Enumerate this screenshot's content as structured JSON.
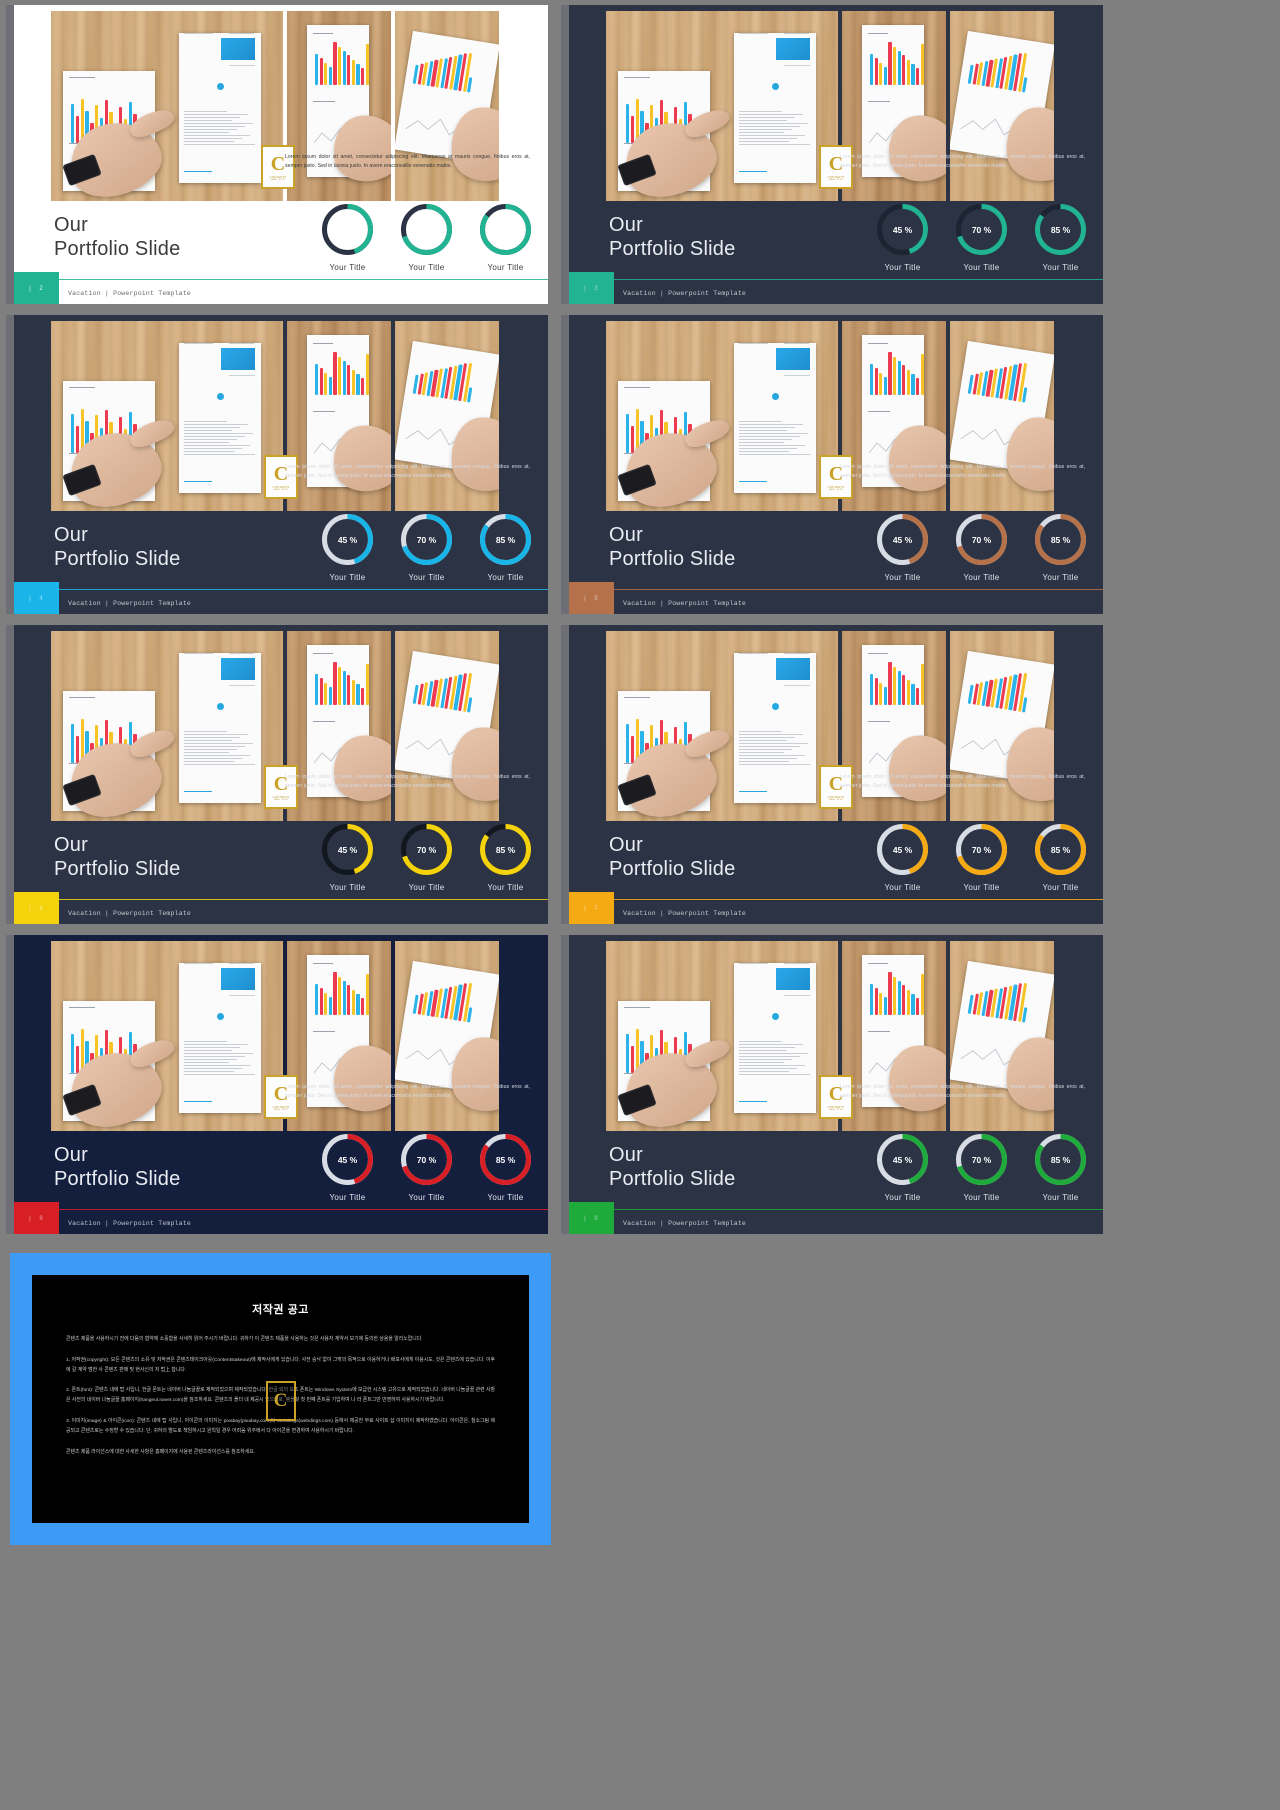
{
  "deck": {
    "headline_line1": "Our",
    "headline_line2": "Portfolio Slide",
    "body_text": "Lorem ipsum dolor sit amet, consectetur adipiscing elit. Maecenas at mauris congue, finibus eros at, semper justo. Sed in lacinia justo. In avere eraconvallis venenatis mattis.",
    "footer_text": "Vacation | Powerpoint Template",
    "donut_labels": [
      "Your Title",
      "Your Title",
      "Your Title"
    ],
    "donut_values": [
      "45 %",
      "70 %",
      "85 %"
    ],
    "donut_percents": [
      45,
      70,
      85
    ],
    "badge": {
      "letter": "C",
      "line1": "CONTENTS",
      "line2": "MALL SITE"
    }
  },
  "slides": [
    {
      "n": "| 2",
      "theme": "light",
      "accent": "#21b392",
      "track": "#2b3344",
      "page": "| 2"
    },
    {
      "n": "| 3",
      "theme": "dark",
      "accent": "#21b392",
      "track": "#1c2431",
      "page": "| 3"
    },
    {
      "n": "| 4",
      "theme": "dark",
      "accent": "#19b5e8",
      "track": "#d8dde5",
      "page": "| 4"
    },
    {
      "n": "| 5",
      "theme": "dark",
      "accent": "#b5714a",
      "track": "#d8dde5",
      "page": "| 5"
    },
    {
      "n": "| 6",
      "theme": "dark",
      "accent": "#f5d30c",
      "track": "#11161f",
      "page": "| 6"
    },
    {
      "n": "| 7",
      "theme": "dark",
      "accent": "#f5a913",
      "track": "#d8dde5",
      "page": "| 7"
    },
    {
      "n": "| 8",
      "theme": "navy",
      "accent": "#d81f26",
      "track": "#d8dde5",
      "page": "| 8"
    },
    {
      "n": "| 9",
      "theme": "dark",
      "accent": "#1faa3c",
      "track": "#d8dde5",
      "page": "| 9"
    }
  ],
  "copyright": {
    "title": "저작권 공고",
    "paragraphs": [
      "콘텐츠 제품을 사용하시기 전에 다음의 협약에 소홀함을 사세히 읽어 주시기 바랍니다. 귀하가 이 콘텐츠 제품을 사용하는 것은 사용자 계약서 보기에 동의한 상용을 알리노랍니다.",
      "1. 저작권(copyright): 모든 콘텐츠의 소유 및 저작권은 콘텐츠테이크아웃(Contentstakeout)에 제작사에게 있습니다. 사전 승낙 없이 그밖의 목적으로 이용하거나 배포사에게 이용시도, 것은 콘텐츠에 있습니다. 이후에 갈 계약 범한 사 콘텐츠 판매 및 현사신의 저 법上 합니다.",
      "2. 폰트(font): 콘텐츠 내에 탑 사입니, 한글 폰트는 네이버 나눔글꼴로 제작되었으며 제작되었습니다. 한글 외의 보조 폰트는 Windows System에 보급한 시스템 고유으로 제작되었습니다. 네이버 나눔글꼴 관련 사항은 사전의 네이버 나눔글꼴 홈페이지(hangeul.naver.com)을 참조하세요. 콘텐츠의 폴더 내 제공시 있으므로, 템플릿 첫 번째 폰트를 기입하여 나 라 폰트그만 반영하여 사용하시기 바랍니다.",
      "3. 이미지(image) & 아이콘(icon): 콘텐츠 내에 탑 사입니, 아이콘의 이미지는 pixabay(pixabay.com)와 Webdings(webdings.com) 등에서 제공한 무료 사이트 삽 이미지이 제작하였습니다. 아이콘은, 칠소그림 제공되고 콘텐츠로는 수정할 수 있습니다. 단, 귀하의 별도로 책임하시고 원칙일 경우 어려움 위주에서 다 아이콘을 변경하여 사용하시기 바랍니다.",
      "콘텐츠 제품 라이선스에 대한 사세한 사항은 홈페이지에 사용된 콘텐츠라이선스를 참조하세요."
    ]
  }
}
